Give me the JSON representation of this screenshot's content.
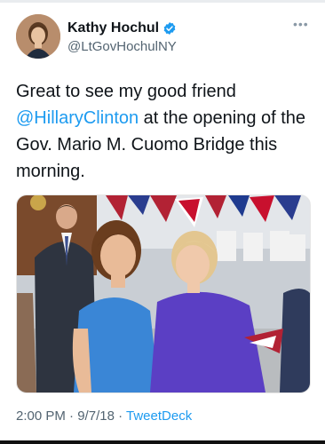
{
  "user": {
    "display_name": "Kathy Hochul",
    "handle": "@LtGovHochulNY",
    "verified_icon": "verified-badge-icon",
    "avatar_icon": "profile-avatar"
  },
  "more_icon": "more-options-icon",
  "tweet": {
    "text_before": "Great to see my good friend ",
    "mention": "@HillaryClinton",
    "text_after": " at the opening of the Gov. Mario M. Cuomo Bridge this morning."
  },
  "photo": {
    "icon": "tweet-photo"
  },
  "meta": {
    "time": "2:00 PM",
    "separator1": " · ",
    "date": "9/7/18",
    "separator2": " · ",
    "source": "TweetDeck"
  },
  "colors": {
    "link": "#1d9bf0",
    "secondary_text": "#536471",
    "verified": "#1d9bf0"
  }
}
